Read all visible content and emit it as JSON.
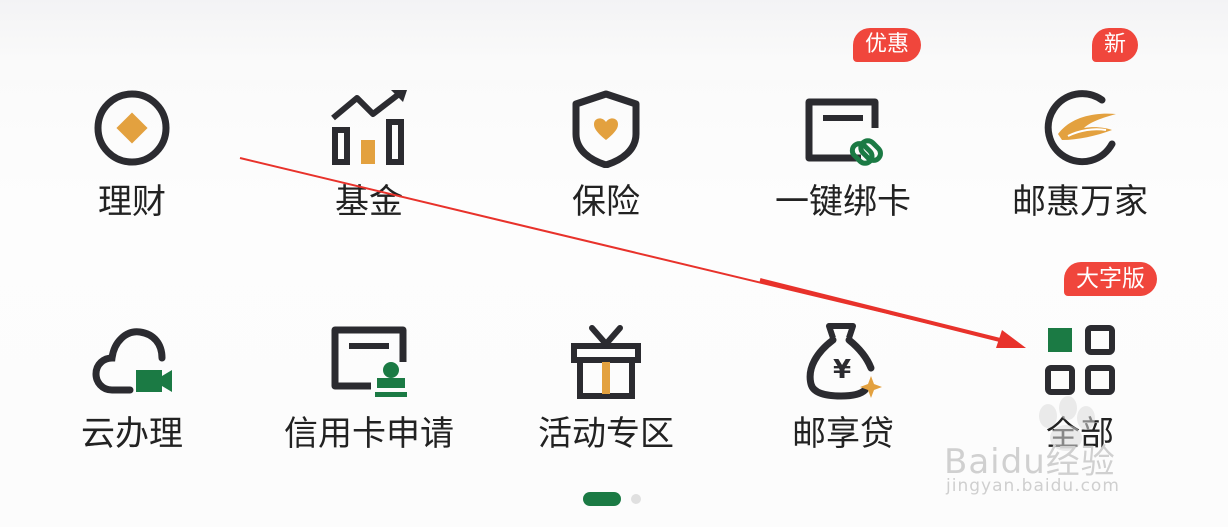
{
  "menu": [
    {
      "label": "理财",
      "icon": "wealth-icon"
    },
    {
      "label": "基金",
      "icon": "fund-chart-icon"
    },
    {
      "label": "保险",
      "icon": "insurance-shield-icon"
    },
    {
      "label": "一键绑卡",
      "icon": "bind-card-icon",
      "badge": "优惠"
    },
    {
      "label": "邮惠万家",
      "icon": "youhui-logo-icon",
      "badge": "新"
    },
    {
      "label": "云办理",
      "icon": "cloud-video-icon"
    },
    {
      "label": "信用卡申请",
      "icon": "credit-card-apply-icon"
    },
    {
      "label": "活动专区",
      "icon": "gift-box-icon"
    },
    {
      "label": "邮享贷",
      "icon": "money-bag-icon"
    },
    {
      "label": "全部",
      "icon": "all-grid-icon",
      "badge": "大字版"
    }
  ],
  "pager": {
    "pages": 2,
    "current": 1
  },
  "watermark": {
    "brand": "Baidu经验",
    "url": "jingyan.baidu.com"
  },
  "colors": {
    "accent_gold": "#e3a13f",
    "accent_green": "#1b7a44",
    "badge_red": "#f0463c",
    "icon_dark": "#2b2b30",
    "arrow_red": "#e8322b"
  }
}
